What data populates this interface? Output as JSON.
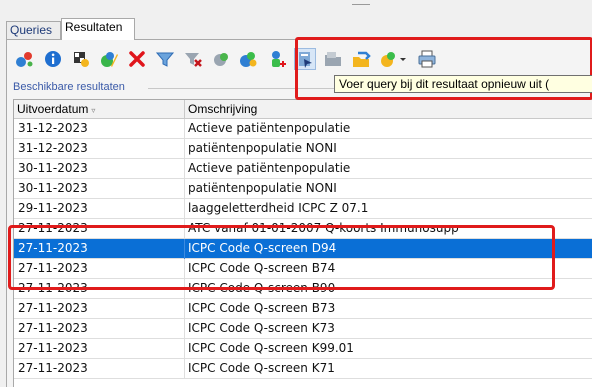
{
  "tabs": [
    {
      "label": "Queries",
      "active": false
    },
    {
      "label": "Resultaten",
      "active": true
    }
  ],
  "toolbar": {
    "buttons": [
      {
        "icon": "new-result-icon"
      },
      {
        "icon": "info-icon"
      },
      {
        "icon": "grid-properties-icon"
      },
      {
        "icon": "edit-icon"
      },
      {
        "icon": "delete-icon"
      },
      {
        "icon": "filter-icon"
      },
      {
        "icon": "clear-filter-icon"
      },
      {
        "icon": "export-icon"
      },
      {
        "icon": "chart-icon"
      },
      {
        "icon": "add-patient-icon"
      },
      {
        "icon": "rerun-query-icon"
      },
      {
        "icon": "folder-icon"
      },
      {
        "icon": "transfer-icon"
      },
      {
        "icon": "group-dropdown-icon"
      },
      {
        "icon": "print-icon"
      }
    ]
  },
  "tooltip": "Voer query bij dit resultaat opnieuw uit (",
  "section_label": "Beschikbare resultaten",
  "table": {
    "columns": [
      "Uitvoerdatum",
      "Omschrijving"
    ],
    "rows": [
      {
        "date": "31-12-2023",
        "desc": "Actieve patiëntenpopulatie",
        "selected": false
      },
      {
        "date": "31-12-2023",
        "desc": "patiëntenpopulatie NONI",
        "selected": false
      },
      {
        "date": "30-11-2023",
        "desc": "Actieve patiëntenpopulatie",
        "selected": false
      },
      {
        "date": "30-11-2023",
        "desc": "patiëntenpopulatie NONI",
        "selected": false
      },
      {
        "date": "29-11-2023",
        "desc": "laaggeletterdheid ICPC Z 07.1",
        "selected": false
      },
      {
        "date": "27-11-2023",
        "desc": "ATC vanaf 01-01-2007 Q-koorts Immunosupp",
        "selected": false
      },
      {
        "date": "27-11-2023",
        "desc": "ICPC Code Q-screen D94",
        "selected": true
      },
      {
        "date": "27-11-2023",
        "desc": "ICPC Code Q-screen B74",
        "selected": false
      },
      {
        "date": "27-11-2023",
        "desc": "ICPC Code Q-screen B90",
        "selected": false
      },
      {
        "date": "27-11-2023",
        "desc": "ICPC Code Q-screen B73",
        "selected": false
      },
      {
        "date": "27-11-2023",
        "desc": "ICPC Code Q-screen K73",
        "selected": false
      },
      {
        "date": "27-11-2023",
        "desc": "ICPC Code Q-screen K99.01",
        "selected": false
      },
      {
        "date": "27-11-2023",
        "desc": "ICPC Code Q-screen K71",
        "selected": false
      }
    ]
  },
  "colors": {
    "selection": "#0a6fd6",
    "highlight": "#e01b1b",
    "tooltip_bg": "#ffffe1"
  }
}
